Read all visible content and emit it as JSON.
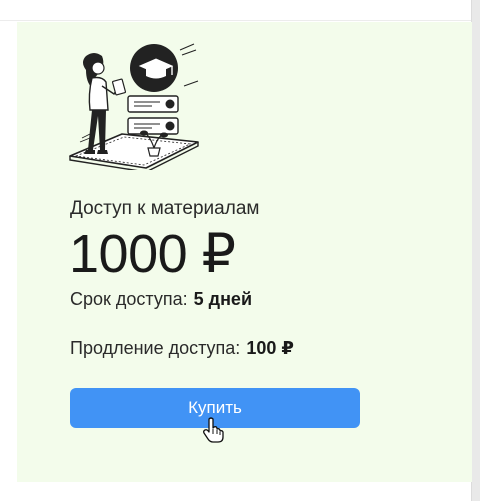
{
  "product": {
    "access_title": "Доступ к материалам",
    "price": "1000 ₽",
    "term_label": "Срок доступа:",
    "term_value": "5 дней",
    "extension_label": "Продление доступа:",
    "extension_value": "100 ₽",
    "buy_label": "Купить"
  },
  "icons": {
    "illustration": "student-learning-illustration",
    "cursor": "hand-pointer-icon"
  },
  "colors": {
    "card_background": "#f3fceb",
    "button": "#4193f5",
    "button_text": "#ffffff"
  }
}
